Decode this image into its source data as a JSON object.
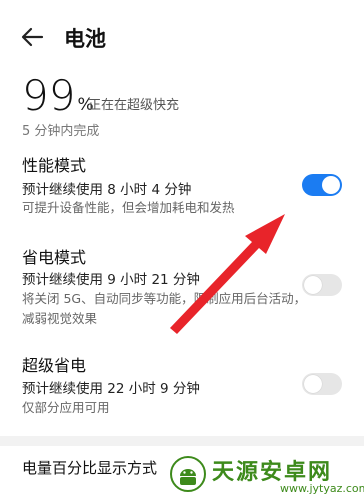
{
  "header": {
    "title": "电池"
  },
  "battery": {
    "percent": "99",
    "percent_sign": "%",
    "status": "正在在超级快充",
    "finish": "5 分钟内完成"
  },
  "modes": [
    {
      "title": "性能模式",
      "estimate": "预计继续使用 8 小时 4 分钟",
      "desc": "可提升设备性能，但会增加耗电和发热",
      "enabled": true
    },
    {
      "title": "省电模式",
      "estimate": "预计继续使用 9 小时 21 分钟",
      "desc": "将关闭 5G、自动同步等功能，限制应用后台活动，减弱视觉效果",
      "enabled": false
    },
    {
      "title": "超级省电",
      "estimate": "预计继续使用 22 小时 9 分钟",
      "desc": "仅部分应用可用",
      "enabled": false
    }
  ],
  "settings": {
    "percent_display": "电量百分比显示方式"
  },
  "watermark": {
    "name": "天源安卓网",
    "url": "www.jytyaz.com"
  },
  "colors": {
    "accent": "#1b7cf2",
    "arrow": "#e8242a",
    "watermark": "#3d8a1b"
  }
}
